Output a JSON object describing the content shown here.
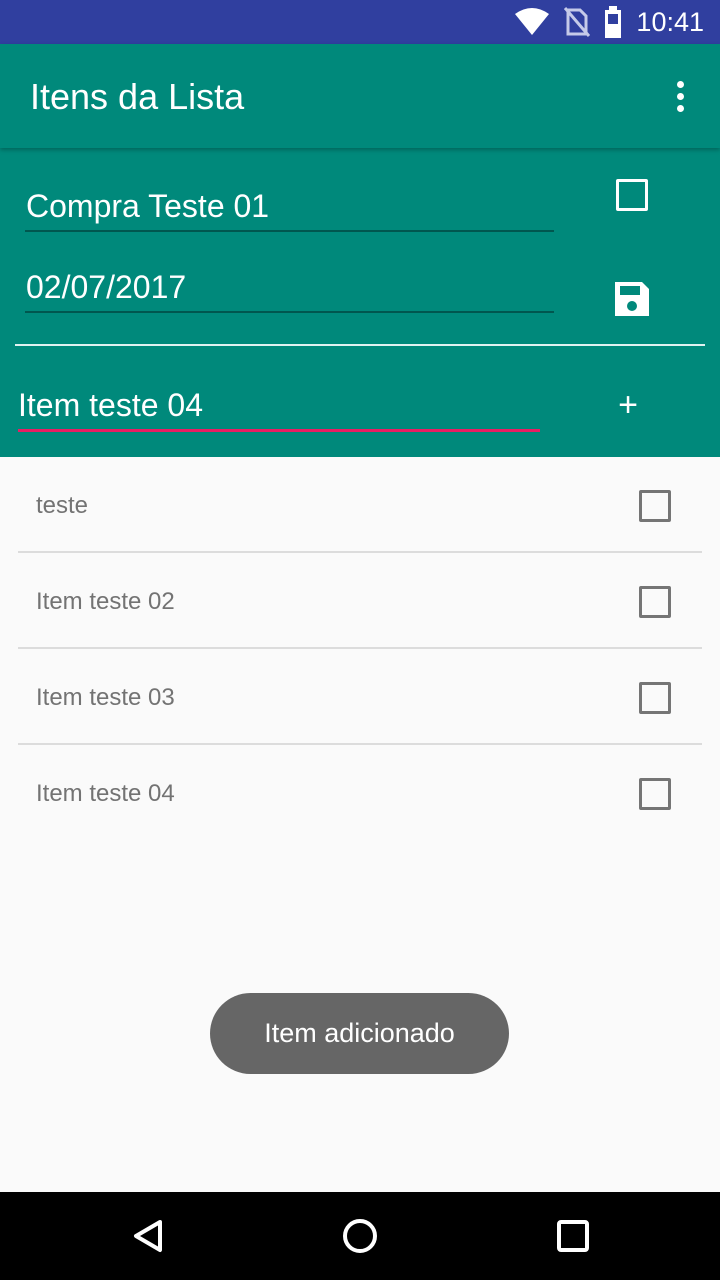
{
  "status_bar": {
    "time": "10:41",
    "icons": [
      "wifi-icon",
      "no-sim-icon",
      "battery-icon"
    ]
  },
  "app_bar": {
    "title": "Itens da Lista",
    "overflow_icon": "more-vert-icon"
  },
  "list_header": {
    "name_value": "Compra Teste 01",
    "date_value": "02/07/2017",
    "new_item_value": "Item teste 04",
    "add_label": "+",
    "save_icon": "save-icon"
  },
  "items": [
    {
      "label": "teste",
      "checked": false
    },
    {
      "label": "Item teste 02",
      "checked": false
    },
    {
      "label": "Item teste 03",
      "checked": false
    },
    {
      "label": "Item teste 04",
      "checked": false
    }
  ],
  "toast": {
    "message": "Item adicionado"
  },
  "nav_bar": {
    "buttons": [
      "back-icon",
      "home-icon",
      "recents-icon"
    ]
  },
  "colors": {
    "primary": "#00897b",
    "primary_dark": "#303f9f",
    "accent": "#e91e63"
  }
}
